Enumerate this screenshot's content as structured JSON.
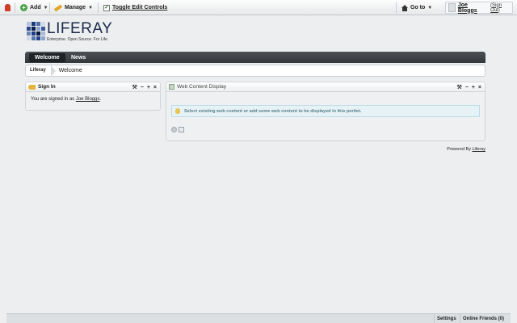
{
  "dockbar": {
    "add_label": "Add",
    "manage_label": "Manage",
    "toggle_label": "Toggle Edit Controls",
    "goto_label": "Go to",
    "user_name": "Joe Bloggs",
    "signout_prefix": "(",
    "signout_label": "Sign Out",
    "signout_suffix": ")"
  },
  "logo": {
    "word": "LIFERAY",
    "tagline": "Enterprise. Open Source. For Life."
  },
  "nav": {
    "tabs": [
      {
        "label": "Welcome"
      },
      {
        "label": "News"
      }
    ]
  },
  "breadcrumb": {
    "root": "Liferay",
    "current": "Welcome"
  },
  "sign_in": {
    "title": "Sign In",
    "text_prefix": "You are signed in as",
    "user_link": "Joe Bloggs",
    "text_suffix": "."
  },
  "web_content": {
    "title": "Web Content Display",
    "message": "Select existing web content or add some web content to be displayed in this portlet."
  },
  "footer": {
    "powered_prefix": "Powered By",
    "powered_link": "Liferay"
  },
  "bottombar": {
    "settings_label": "Settings",
    "friends_label": "Online Friends (0)"
  },
  "colors": {
    "nav_bg": "#3f4246",
    "info_bg": "#e6f2f6",
    "info_text": "#5b7f8c",
    "logo_blue": "#1c2a4a"
  }
}
